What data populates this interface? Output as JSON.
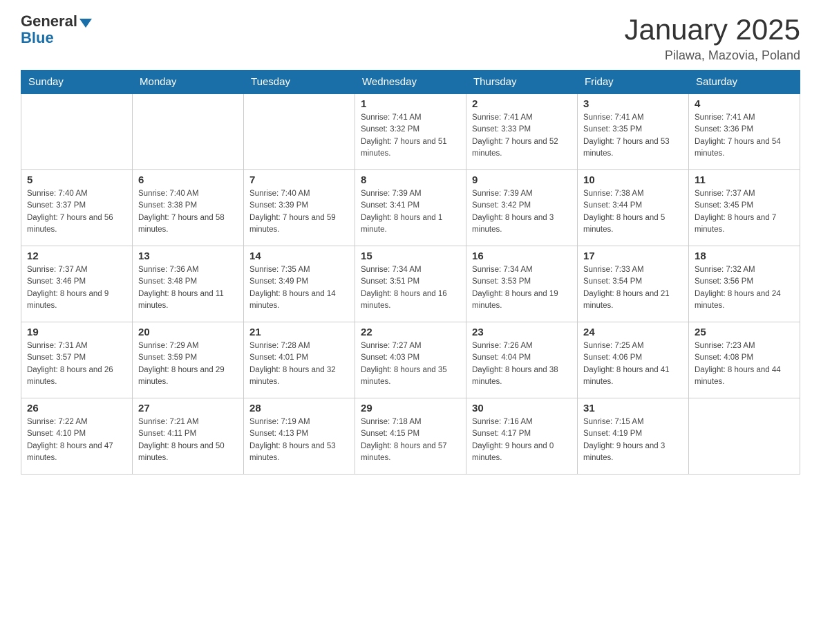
{
  "header": {
    "logo_general": "General",
    "logo_blue": "Blue",
    "month_title": "January 2025",
    "location": "Pilawa, Mazovia, Poland"
  },
  "weekdays": [
    "Sunday",
    "Monday",
    "Tuesday",
    "Wednesday",
    "Thursday",
    "Friday",
    "Saturday"
  ],
  "weeks": [
    [
      {
        "day": "",
        "sunrise": "",
        "sunset": "",
        "daylight": ""
      },
      {
        "day": "",
        "sunrise": "",
        "sunset": "",
        "daylight": ""
      },
      {
        "day": "",
        "sunrise": "",
        "sunset": "",
        "daylight": ""
      },
      {
        "day": "1",
        "sunrise": "Sunrise: 7:41 AM",
        "sunset": "Sunset: 3:32 PM",
        "daylight": "Daylight: 7 hours and 51 minutes."
      },
      {
        "day": "2",
        "sunrise": "Sunrise: 7:41 AM",
        "sunset": "Sunset: 3:33 PM",
        "daylight": "Daylight: 7 hours and 52 minutes."
      },
      {
        "day": "3",
        "sunrise": "Sunrise: 7:41 AM",
        "sunset": "Sunset: 3:35 PM",
        "daylight": "Daylight: 7 hours and 53 minutes."
      },
      {
        "day": "4",
        "sunrise": "Sunrise: 7:41 AM",
        "sunset": "Sunset: 3:36 PM",
        "daylight": "Daylight: 7 hours and 54 minutes."
      }
    ],
    [
      {
        "day": "5",
        "sunrise": "Sunrise: 7:40 AM",
        "sunset": "Sunset: 3:37 PM",
        "daylight": "Daylight: 7 hours and 56 minutes."
      },
      {
        "day": "6",
        "sunrise": "Sunrise: 7:40 AM",
        "sunset": "Sunset: 3:38 PM",
        "daylight": "Daylight: 7 hours and 58 minutes."
      },
      {
        "day": "7",
        "sunrise": "Sunrise: 7:40 AM",
        "sunset": "Sunset: 3:39 PM",
        "daylight": "Daylight: 7 hours and 59 minutes."
      },
      {
        "day": "8",
        "sunrise": "Sunrise: 7:39 AM",
        "sunset": "Sunset: 3:41 PM",
        "daylight": "Daylight: 8 hours and 1 minute."
      },
      {
        "day": "9",
        "sunrise": "Sunrise: 7:39 AM",
        "sunset": "Sunset: 3:42 PM",
        "daylight": "Daylight: 8 hours and 3 minutes."
      },
      {
        "day": "10",
        "sunrise": "Sunrise: 7:38 AM",
        "sunset": "Sunset: 3:44 PM",
        "daylight": "Daylight: 8 hours and 5 minutes."
      },
      {
        "day": "11",
        "sunrise": "Sunrise: 7:37 AM",
        "sunset": "Sunset: 3:45 PM",
        "daylight": "Daylight: 8 hours and 7 minutes."
      }
    ],
    [
      {
        "day": "12",
        "sunrise": "Sunrise: 7:37 AM",
        "sunset": "Sunset: 3:46 PM",
        "daylight": "Daylight: 8 hours and 9 minutes."
      },
      {
        "day": "13",
        "sunrise": "Sunrise: 7:36 AM",
        "sunset": "Sunset: 3:48 PM",
        "daylight": "Daylight: 8 hours and 11 minutes."
      },
      {
        "day": "14",
        "sunrise": "Sunrise: 7:35 AM",
        "sunset": "Sunset: 3:49 PM",
        "daylight": "Daylight: 8 hours and 14 minutes."
      },
      {
        "day": "15",
        "sunrise": "Sunrise: 7:34 AM",
        "sunset": "Sunset: 3:51 PM",
        "daylight": "Daylight: 8 hours and 16 minutes."
      },
      {
        "day": "16",
        "sunrise": "Sunrise: 7:34 AM",
        "sunset": "Sunset: 3:53 PM",
        "daylight": "Daylight: 8 hours and 19 minutes."
      },
      {
        "day": "17",
        "sunrise": "Sunrise: 7:33 AM",
        "sunset": "Sunset: 3:54 PM",
        "daylight": "Daylight: 8 hours and 21 minutes."
      },
      {
        "day": "18",
        "sunrise": "Sunrise: 7:32 AM",
        "sunset": "Sunset: 3:56 PM",
        "daylight": "Daylight: 8 hours and 24 minutes."
      }
    ],
    [
      {
        "day": "19",
        "sunrise": "Sunrise: 7:31 AM",
        "sunset": "Sunset: 3:57 PM",
        "daylight": "Daylight: 8 hours and 26 minutes."
      },
      {
        "day": "20",
        "sunrise": "Sunrise: 7:29 AM",
        "sunset": "Sunset: 3:59 PM",
        "daylight": "Daylight: 8 hours and 29 minutes."
      },
      {
        "day": "21",
        "sunrise": "Sunrise: 7:28 AM",
        "sunset": "Sunset: 4:01 PM",
        "daylight": "Daylight: 8 hours and 32 minutes."
      },
      {
        "day": "22",
        "sunrise": "Sunrise: 7:27 AM",
        "sunset": "Sunset: 4:03 PM",
        "daylight": "Daylight: 8 hours and 35 minutes."
      },
      {
        "day": "23",
        "sunrise": "Sunrise: 7:26 AM",
        "sunset": "Sunset: 4:04 PM",
        "daylight": "Daylight: 8 hours and 38 minutes."
      },
      {
        "day": "24",
        "sunrise": "Sunrise: 7:25 AM",
        "sunset": "Sunset: 4:06 PM",
        "daylight": "Daylight: 8 hours and 41 minutes."
      },
      {
        "day": "25",
        "sunrise": "Sunrise: 7:23 AM",
        "sunset": "Sunset: 4:08 PM",
        "daylight": "Daylight: 8 hours and 44 minutes."
      }
    ],
    [
      {
        "day": "26",
        "sunrise": "Sunrise: 7:22 AM",
        "sunset": "Sunset: 4:10 PM",
        "daylight": "Daylight: 8 hours and 47 minutes."
      },
      {
        "day": "27",
        "sunrise": "Sunrise: 7:21 AM",
        "sunset": "Sunset: 4:11 PM",
        "daylight": "Daylight: 8 hours and 50 minutes."
      },
      {
        "day": "28",
        "sunrise": "Sunrise: 7:19 AM",
        "sunset": "Sunset: 4:13 PM",
        "daylight": "Daylight: 8 hours and 53 minutes."
      },
      {
        "day": "29",
        "sunrise": "Sunrise: 7:18 AM",
        "sunset": "Sunset: 4:15 PM",
        "daylight": "Daylight: 8 hours and 57 minutes."
      },
      {
        "day": "30",
        "sunrise": "Sunrise: 7:16 AM",
        "sunset": "Sunset: 4:17 PM",
        "daylight": "Daylight: 9 hours and 0 minutes."
      },
      {
        "day": "31",
        "sunrise": "Sunrise: 7:15 AM",
        "sunset": "Sunset: 4:19 PM",
        "daylight": "Daylight: 9 hours and 3 minutes."
      },
      {
        "day": "",
        "sunrise": "",
        "sunset": "",
        "daylight": ""
      }
    ]
  ]
}
